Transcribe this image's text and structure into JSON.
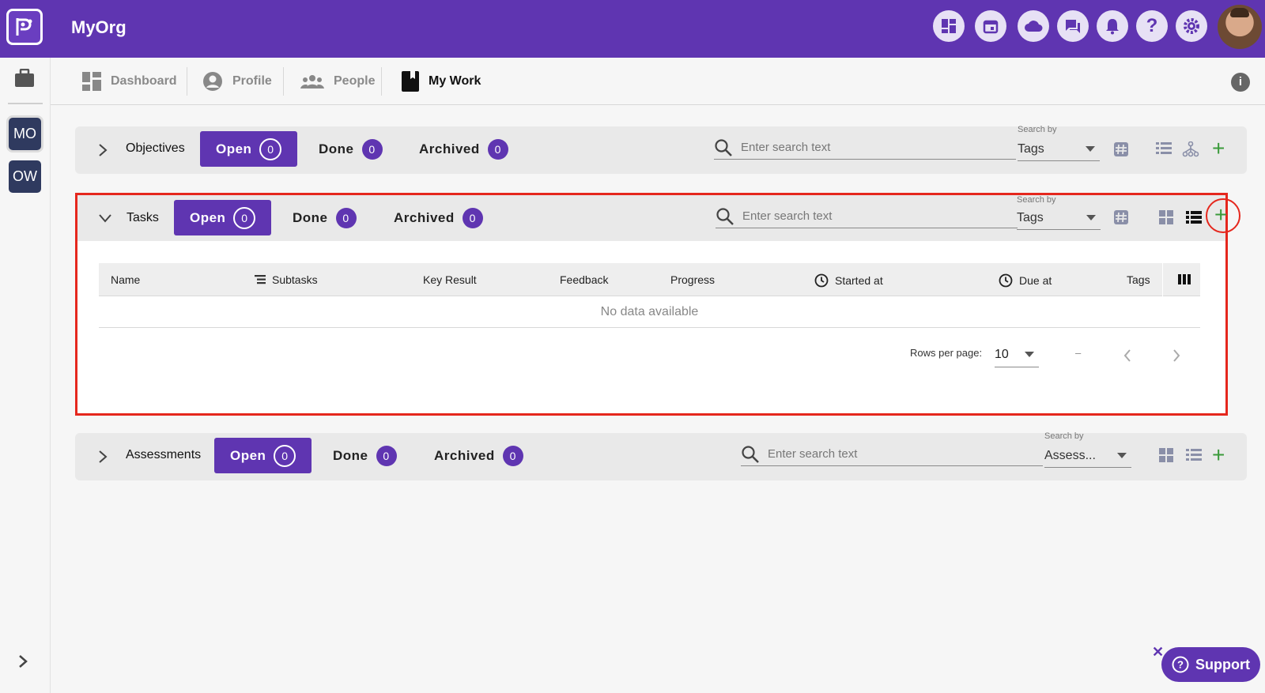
{
  "app": {
    "title": "MyOrg"
  },
  "topbar": {
    "icons": [
      "dashboard-icon",
      "calendar-icon",
      "cloud-icon",
      "chat-icon",
      "bell-icon",
      "help-icon",
      "settings-icon"
    ]
  },
  "rail": {
    "orgs": [
      {
        "label": "MO",
        "active": true
      },
      {
        "label": "OW",
        "active": false
      }
    ]
  },
  "nav": {
    "items": [
      {
        "label": "Dashboard",
        "icon": "grid-icon"
      },
      {
        "label": "Profile",
        "icon": "account-icon"
      },
      {
        "label": "People",
        "icon": "people-icon"
      },
      {
        "label": "My Work",
        "icon": "notebook-icon",
        "active": true
      }
    ]
  },
  "objectives": {
    "title": "Objectives",
    "tabs": [
      {
        "label": "Open",
        "count": "0"
      },
      {
        "label": "Done",
        "count": "0"
      },
      {
        "label": "Archived",
        "count": "0"
      }
    ],
    "search_placeholder": "Enter search text",
    "search_by_label": "Search by",
    "search_by_value": "Tags"
  },
  "tasks": {
    "title": "Tasks",
    "tabs": [
      {
        "label": "Open",
        "count": "0"
      },
      {
        "label": "Done",
        "count": "0"
      },
      {
        "label": "Archived",
        "count": "0"
      }
    ],
    "search_placeholder": "Enter search text",
    "search_by_label": "Search by",
    "search_by_value": "Tags",
    "columns": [
      "Name",
      "Subtasks",
      "Key Result",
      "Feedback",
      "Progress",
      "Started at",
      "Due at",
      "Tags"
    ],
    "empty_text": "No data available",
    "rows_per_page_label": "Rows per page:",
    "rows_per_page": "10",
    "page_range": "–"
  },
  "assessments": {
    "title": "Assessments",
    "tabs": [
      {
        "label": "Open",
        "count": "0"
      },
      {
        "label": "Done",
        "count": "0"
      },
      {
        "label": "Archived",
        "count": "0"
      }
    ],
    "search_placeholder": "Enter search text",
    "search_by_label": "Search by",
    "search_by_value": "Assess..."
  },
  "support": {
    "label": "Support",
    "close": "✕"
  },
  "colors": {
    "brand": "#5f35b1",
    "add": "#3a9a3a",
    "highlight": "#e5271d"
  }
}
